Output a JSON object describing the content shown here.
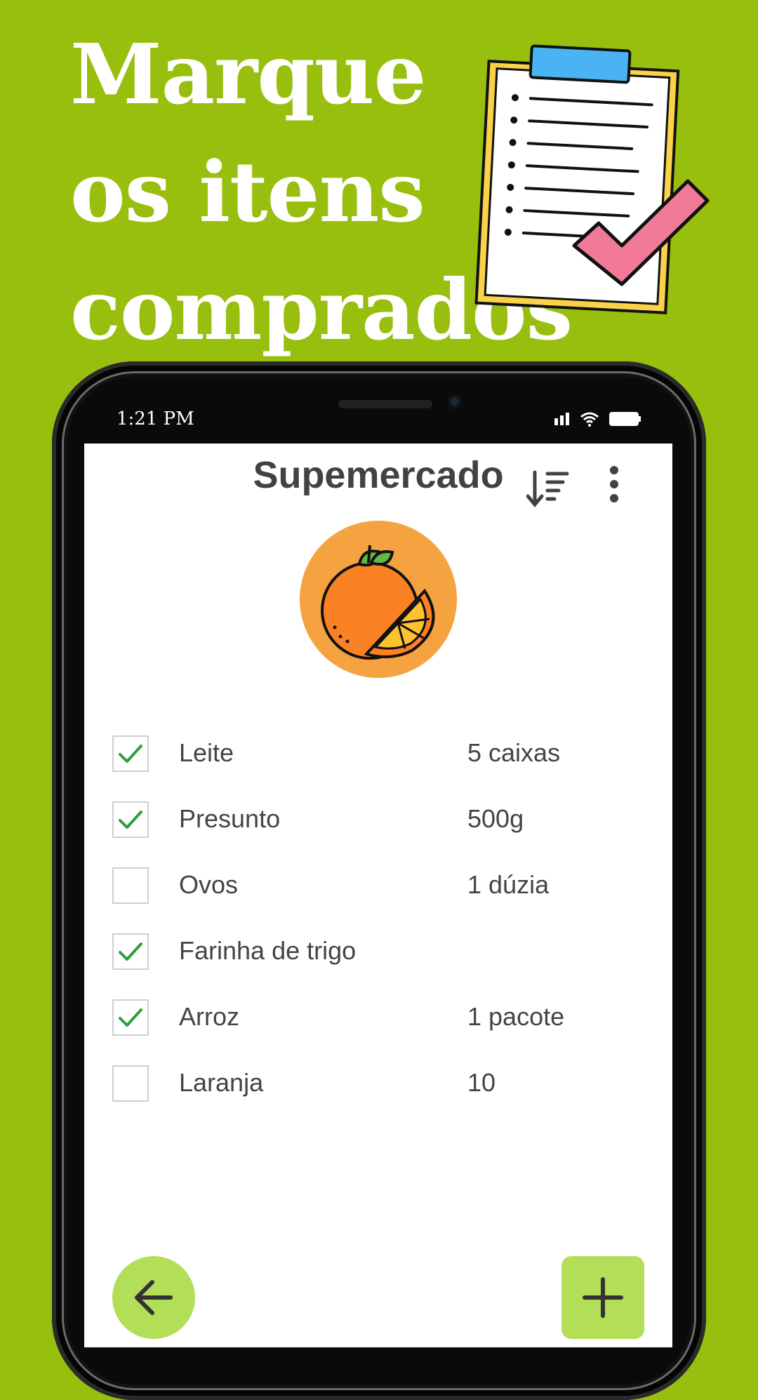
{
  "headline": {
    "line1": "Marque",
    "line2": "os itens",
    "line3": "comprados"
  },
  "status_bar": {
    "time": "1:21 PM",
    "icons": [
      "signal-icon",
      "wifi-icon",
      "battery-icon"
    ]
  },
  "app_bar": {
    "title": "Supemercado",
    "actions": [
      "sort-icon",
      "more-vert-icon"
    ]
  },
  "category": {
    "icon": "orange-icon",
    "color": "#f4a340"
  },
  "items": [
    {
      "name": "Leite",
      "quantity": "5 caixas",
      "checked": true
    },
    {
      "name": "Presunto",
      "quantity": "500g",
      "checked": true
    },
    {
      "name": "Ovos",
      "quantity": "1 dúzia",
      "checked": false
    },
    {
      "name": "Farinha de trigo",
      "quantity": "",
      "checked": true
    },
    {
      "name": "Arroz",
      "quantity": "1 pacote",
      "checked": true
    },
    {
      "name": "Laranja",
      "quantity": "10",
      "checked": false
    }
  ],
  "fab": {
    "back_icon": "arrow-left-icon",
    "add_icon": "plus-icon",
    "color": "#b2de58"
  },
  "colors": {
    "background": "#98bf0e",
    "check": "#2e9e3e",
    "text": "#444444"
  }
}
